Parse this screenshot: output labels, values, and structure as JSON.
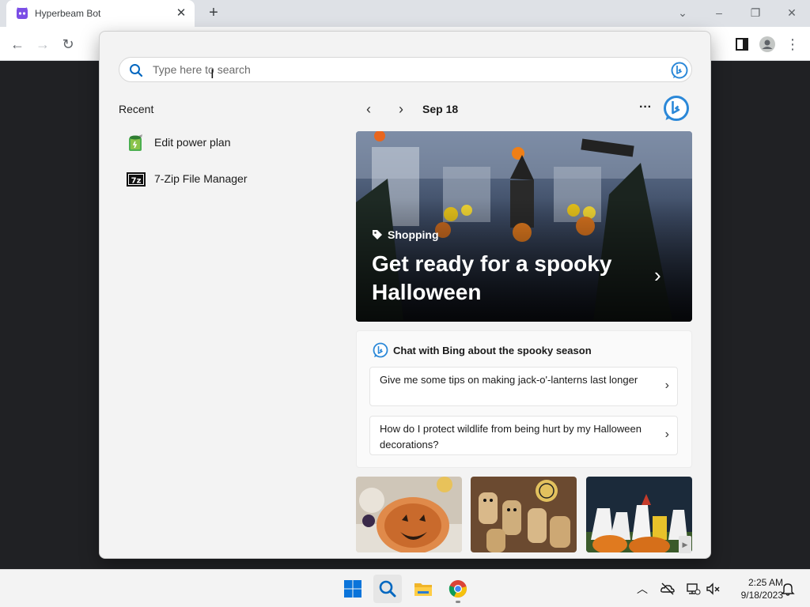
{
  "browser": {
    "tab_title": "Hyperbeam Bot",
    "tab_close_icon": "close-icon",
    "new_tab_icon": "plus-icon"
  },
  "search": {
    "placeholder": "Type here to search"
  },
  "recent": {
    "title": "Recent",
    "items": [
      {
        "label": "Edit power plan",
        "icon": "power-plan-icon"
      },
      {
        "label": "7-Zip File Manager",
        "icon": "7zip-icon",
        "icon_text": "7z"
      }
    ]
  },
  "feed": {
    "date": "Sep 18",
    "more_label": "···",
    "hero": {
      "tag": "Shopping",
      "title": "Get ready for a spooky Halloween"
    },
    "chat": {
      "title": "Chat with Bing about the spooky season",
      "prompts": [
        "Give me some tips on making jack-o'-lanterns last longer",
        "How do I protect wildlife from being hurt by my Halloween decorations?"
      ]
    }
  },
  "taskbar": {
    "time": "2:25 AM",
    "date": "9/18/2023",
    "apps": [
      "windows-start-icon",
      "search-icon",
      "file-explorer-icon",
      "chrome-icon"
    ]
  },
  "colors": {
    "accent": "#0067c0",
    "bing_blue": "#2b88d8",
    "hero_overlay": "#1f2533"
  }
}
